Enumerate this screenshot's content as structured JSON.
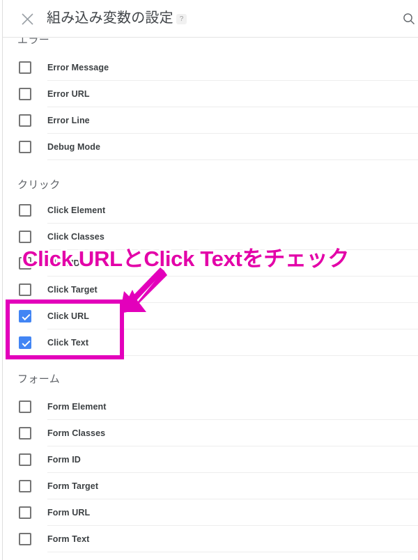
{
  "header": {
    "title": "組み込み変数の設定",
    "help_label": "?",
    "close_icon": "close-icon",
    "search_icon": "search-icon"
  },
  "sections": [
    {
      "id": "error",
      "title": "エラー",
      "items": [
        {
          "label": "Error Message",
          "checked": false
        },
        {
          "label": "Error URL",
          "checked": false
        },
        {
          "label": "Error Line",
          "checked": false
        },
        {
          "label": "Debug Mode",
          "checked": false
        }
      ]
    },
    {
      "id": "click",
      "title": "クリック",
      "items": [
        {
          "label": "Click Element",
          "checked": false
        },
        {
          "label": "Click Classes",
          "checked": false
        },
        {
          "label": "Click ID",
          "checked": false
        },
        {
          "label": "Click Target",
          "checked": false
        },
        {
          "label": "Click URL",
          "checked": true
        },
        {
          "label": "Click Text",
          "checked": true
        }
      ]
    },
    {
      "id": "form",
      "title": "フォーム",
      "items": [
        {
          "label": "Form Element",
          "checked": false
        },
        {
          "label": "Form Classes",
          "checked": false
        },
        {
          "label": "Form ID",
          "checked": false
        },
        {
          "label": "Form Target",
          "checked": false
        },
        {
          "label": "Form URL",
          "checked": false
        },
        {
          "label": "Form Text",
          "checked": false
        }
      ]
    }
  ],
  "annotation": {
    "text": "Click URLとClick Textをチェック",
    "color": "#e300a8",
    "box_color": "#e300bb",
    "arrow_color": "#e300bb"
  },
  "theme": {
    "checkbox_checked_color": "#4285f4",
    "text_color": "#3c4043",
    "section_title_color": "#5f6368",
    "divider_color": "#ededed"
  }
}
